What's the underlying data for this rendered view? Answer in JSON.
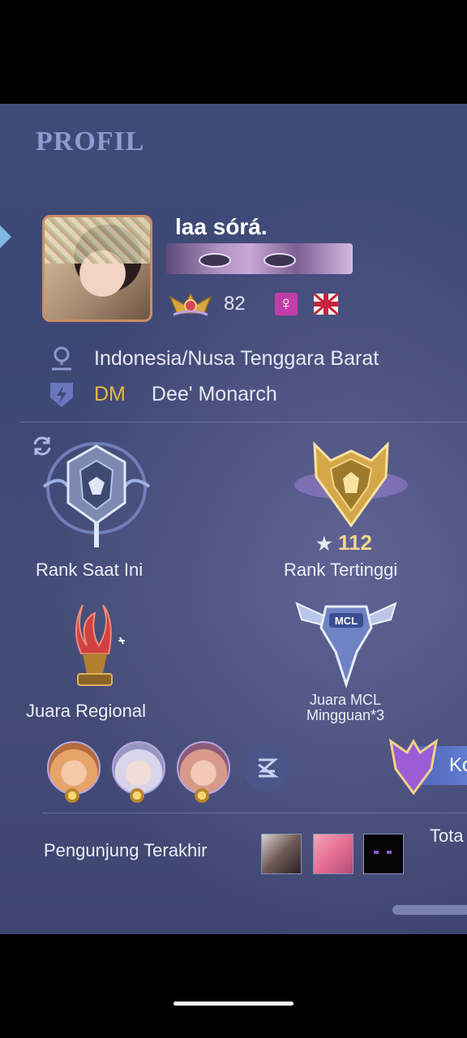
{
  "header": {
    "title": "PROFIL"
  },
  "player": {
    "name": "laa sórá.",
    "level": "82",
    "location": "Indonesia/Nusa Tenggara Barat",
    "squad_tag": "DM",
    "squad_name": "Dee' Monarch"
  },
  "ranks": {
    "current_label": "Rank Saat Ini",
    "highest_label": "Rank Tertinggi",
    "highest_stars": "112"
  },
  "achievements": {
    "regional_label": "Juara Regional",
    "mcl_label_line1": "Juara MCL",
    "mcl_label_line2": "Mingguan*3"
  },
  "rank_pill": {
    "text": "Ko"
  },
  "visitors": {
    "label": "Pengunjung Terakhir",
    "total_label": "Tota"
  },
  "colors": {
    "accent_gold": "#e9b64a",
    "gender_badge": "#c23ea7",
    "title": "#8f9ad0"
  },
  "icons": [
    "location-pin-icon",
    "squad-shield-icon",
    "sync-icon",
    "level-badge-icon",
    "female-gender-icon",
    "uk-flag-icon",
    "star-icon",
    "more-heroes-icon"
  ]
}
